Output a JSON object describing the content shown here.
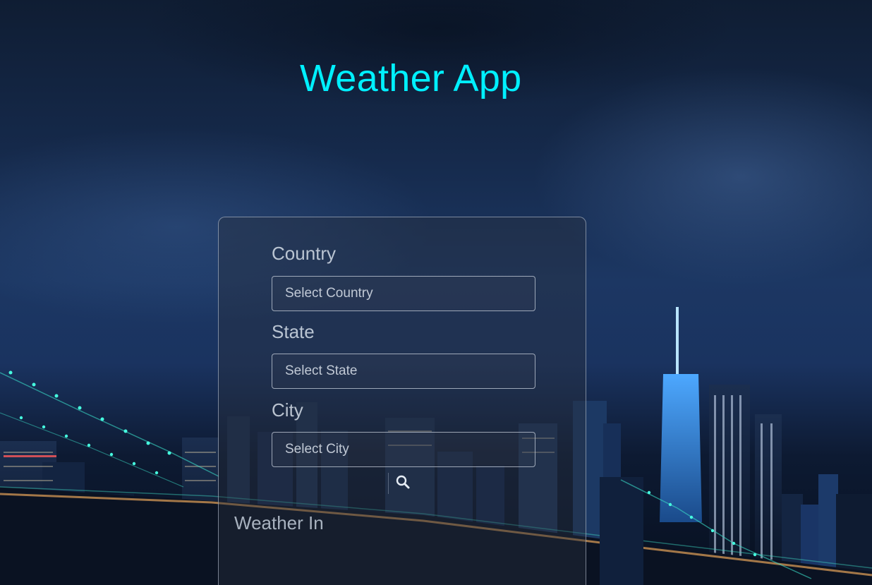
{
  "header": {
    "title": "Weather App"
  },
  "form": {
    "country_label": "Country",
    "country_selected": "Select Country",
    "state_label": "State",
    "state_selected": "Select State",
    "city_label": "City",
    "city_selected": "Select City",
    "search_icon": "search-icon"
  },
  "result": {
    "heading": "Weather In"
  },
  "colors": {
    "title": "#00f0ff",
    "panel_border": "#c8d2e1",
    "text": "#dce4ee"
  }
}
